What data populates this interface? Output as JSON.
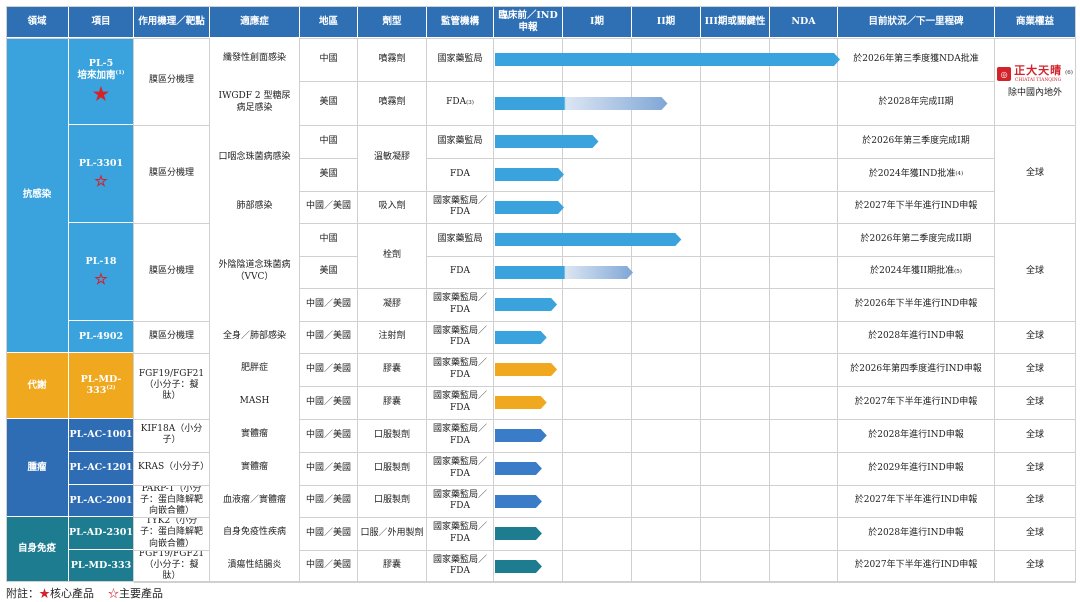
{
  "chart_data": {
    "type": "table",
    "headers": [
      "領域",
      "項目",
      "作用機理／靶點",
      "適應症",
      "地區",
      "劑型",
      "監管機構",
      "臨床前／IND申報",
      "I期",
      "II期",
      "III期或關鍵性",
      "NDA",
      "目前狀況／下一里程碑",
      "商業權益"
    ],
    "areas": [
      {
        "label": "抗感染",
        "color": "#3aa2dc"
      },
      {
        "label": "代謝",
        "color": "#f0a81e"
      },
      {
        "label": "腫瘤",
        "color": "#2e6db4"
      },
      {
        "label": "自身免疫",
        "color": "#1d7c8f"
      }
    ],
    "projects": [
      {
        "name": "PL-5",
        "sub": "培來加南",
        "note": "(1)",
        "star": "solid",
        "mech": "膜區分機理"
      },
      {
        "name": "PL-3301",
        "sub": "",
        "note": "",
        "star": "hollow",
        "mech": "膜區分機理"
      },
      {
        "name": "PL-18",
        "sub": "",
        "note": "",
        "star": "hollow",
        "mech": "膜區分機理"
      },
      {
        "name": "PL-4902",
        "sub": "",
        "note": "",
        "star": "",
        "mech": "膜區分機理"
      },
      {
        "name": "PL-MD-333",
        "sub": "",
        "note": "(2)",
        "star": "",
        "mech": "FGF19/FGF21（小分子：擬肽）"
      },
      {
        "name": "PL-AC-1001",
        "sub": "",
        "note": "",
        "star": "",
        "mech": "KIF18A（小分子）"
      },
      {
        "name": "PL-AC-1201",
        "sub": "",
        "note": "",
        "star": "",
        "mech": "KRAS（小分子）"
      },
      {
        "name": "PL-AC-2001",
        "sub": "",
        "note": "",
        "star": "",
        "mech": "PARP-1（小分子：蛋白降解靶向嵌合體）"
      },
      {
        "name": "PL-AD-2301",
        "sub": "",
        "note": "",
        "star": "",
        "mech": "TYK2（小分子：蛋白降解靶向嵌合體）"
      },
      {
        "name": "PL-MD-333",
        "sub": "",
        "note": "",
        "star": "",
        "mech": "FGF19/FGF21（小分子：擬肽）"
      }
    ],
    "indications": [
      "纖發性創面感染",
      "IWGDF 2 型糖尿病足感染",
      "口咽念珠菌病感染",
      "肺部感染",
      "外陰陰道念珠菌病（VVC）",
      "全身／肺部感染",
      "肥胖症",
      "MASH",
      "實體瘤",
      "實體瘤",
      "血液瘤／實體瘤",
      "自身免疫性疾病",
      "潰瘍性結腸炎"
    ],
    "rows": [
      {
        "region": "中國",
        "form": "噴霧劑",
        "regulator": "國家藥監局",
        "phase_progress": 5.0,
        "status": "於2026年第三季度獲NDA批准",
        "gradient": false
      },
      {
        "region": "美國",
        "form": "噴霧劑",
        "regulator": "FDA",
        "regulator_note": "(3)",
        "phase_progress": 2.5,
        "status": "於2028年完成II期",
        "gradient": true
      },
      {
        "region": "中國",
        "form": "溫敏凝膠",
        "regulator": "國家藥監局",
        "phase_progress": 1.5,
        "status": "於2026年第三季度完成I期",
        "gradient": false
      },
      {
        "region": "美國",
        "form": "",
        "regulator": "FDA",
        "phase_progress": 1.0,
        "status": "於2024年獲IND批准",
        "status_note": "(4)",
        "gradient": false
      },
      {
        "region": "中國／美國",
        "form": "吸入劑",
        "regulator": "國家藥監局／FDA",
        "phase_progress": 1.0,
        "status": "於2027年下半年進行IND申報",
        "gradient": false
      },
      {
        "region": "中國",
        "form": "栓劑",
        "regulator": "國家藥監局",
        "phase_progress": 2.7,
        "status": "於2026年第二季度完成II期",
        "gradient": false
      },
      {
        "region": "美國",
        "form": "",
        "regulator": "FDA",
        "phase_progress": 2.0,
        "status": "於2024年獲II期批准",
        "status_note": "(5)",
        "gradient": true
      },
      {
        "region": "中國／美國",
        "form": "凝膠",
        "regulator": "國家藥監局／FDA",
        "phase_progress": 0.9,
        "status": "於2026年下半年進行IND申報",
        "gradient": false
      },
      {
        "region": "中國／美國",
        "form": "注射劑",
        "regulator": "國家藥監局／FDA",
        "phase_progress": 0.75,
        "status": "於2028年進行IND申報",
        "gradient": false
      },
      {
        "region": "中國／美國",
        "form": "膠囊",
        "regulator": "國家藥監局／FDA",
        "phase_progress": 0.9,
        "status": "於2026年第四季度進行IND申報",
        "gradient": false
      },
      {
        "region": "中國／美國",
        "form": "膠囊",
        "regulator": "國家藥監局／FDA",
        "phase_progress": 0.75,
        "status": "於2027年下半年進行IND申報",
        "gradient": false
      },
      {
        "region": "中國／美國",
        "form": "口服製劑",
        "regulator": "國家藥監局／FDA",
        "phase_progress": 0.75,
        "status": "於2028年進行IND申報",
        "gradient": false
      },
      {
        "region": "中國／美國",
        "form": "口服製劑",
        "regulator": "國家藥監局／FDA",
        "phase_progress": 0.68,
        "status": "於2029年進行IND申報",
        "gradient": false
      },
      {
        "region": "中國／美國",
        "form": "口服製劑",
        "regulator": "國家藥監局／FDA",
        "phase_progress": 0.68,
        "status": "於2027年下半年進行IND申報",
        "gradient": false
      },
      {
        "region": "中國／美國",
        "form": "口服／外用製劑",
        "regulator": "國家藥監局／FDA",
        "phase_progress": 0.68,
        "status": "於2028年進行IND申報",
        "gradient": false
      },
      {
        "region": "中國／美國",
        "form": "膠囊",
        "regulator": "國家藥監局／FDA",
        "phase_progress": 0.68,
        "status": "於2027年下半年進行IND申報",
        "gradient": false
      }
    ],
    "rights": [
      "除中國內地外",
      "全球",
      "全球",
      "全球",
      "全球",
      "全球",
      "全球",
      "全球",
      "全球",
      "全球",
      "全球",
      "全球"
    ],
    "partner_logo": {
      "cn": "正大天晴",
      "en": "CHIATAI TIANQING",
      "note": "(6)"
    },
    "footnote": {
      "prefix": "附註：",
      "core": "核心產品",
      "main": "主要產品"
    }
  }
}
